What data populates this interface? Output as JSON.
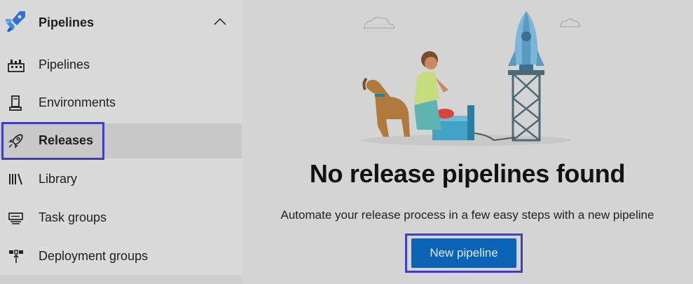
{
  "sidebar": {
    "header_title": "Pipelines",
    "items": [
      {
        "label": "Pipelines",
        "icon": "pipelines-icon"
      },
      {
        "label": "Environments",
        "icon": "environments-icon"
      },
      {
        "label": "Releases",
        "icon": "rocket-icon",
        "selected": true
      },
      {
        "label": "Library",
        "icon": "library-icon"
      },
      {
        "label": "Task groups",
        "icon": "task-groups-icon"
      },
      {
        "label": "Deployment groups",
        "icon": "deployment-groups-icon"
      }
    ]
  },
  "main": {
    "empty_title": "No release pipelines found",
    "empty_description": "Automate your release process in a few easy steps with a new pipeline",
    "new_pipeline_label": "New pipeline"
  },
  "colors": {
    "highlight": "#3f3fc4",
    "button": "#0a63b4",
    "logo": "#2f6fd6"
  }
}
